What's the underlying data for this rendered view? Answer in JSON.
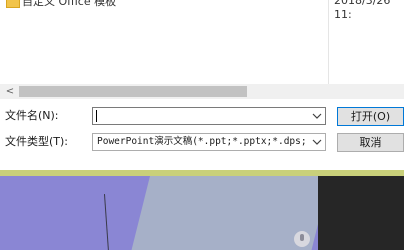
{
  "file_list": {
    "rows": [
      {
        "icon": "folder-icon",
        "name": "自定义 Office 模板",
        "date": "2018/3/26 11:"
      }
    ]
  },
  "scrollbar": {
    "left_arrow": "<"
  },
  "filename": {
    "label": "文件名(N):",
    "value": ""
  },
  "filetype": {
    "label": "文件类型(T):",
    "value": "PowerPoint演示文稿(*.ppt;*.pptx;*.dps;"
  },
  "buttons": {
    "open": "打开(O)",
    "cancel": "取消"
  },
  "colors": {
    "accent": "#0078d7",
    "button_bg": "#e1e1e1",
    "background_purple": "#8a86d4",
    "background_strip": "#c9d07a"
  }
}
